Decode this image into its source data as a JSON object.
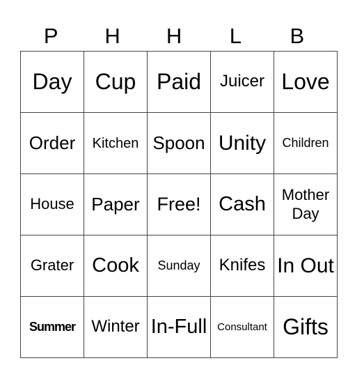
{
  "header": [
    "P",
    "H",
    "H",
    "L",
    "B"
  ],
  "rows": [
    [
      "Day",
      "Cup",
      "Paid",
      "Juicer",
      "Love"
    ],
    [
      "Order",
      "Kitchen",
      "Spoon",
      "Unity",
      "Children"
    ],
    [
      "House",
      "Paper",
      "Free!",
      "Cash",
      "Mother Day"
    ],
    [
      "Grater",
      "Cook",
      "Sunday",
      "Knifes",
      "In Out"
    ],
    [
      "Summer",
      "Winter",
      "In-Full",
      "Consultant",
      "Gifts"
    ]
  ]
}
